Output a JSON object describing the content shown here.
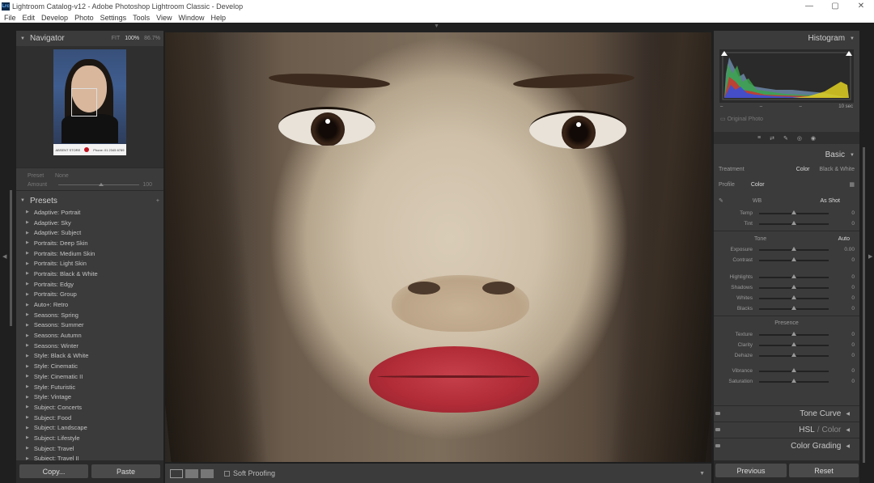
{
  "window": {
    "title": "Lightroom Catalog-v12 - Adobe Photoshop Lightroom Classic - Develop",
    "app_icon": "Lrc",
    "controls": [
      "—",
      "▢",
      "✕"
    ]
  },
  "menu": [
    "File",
    "Edit",
    "Develop",
    "Photo",
    "Settings",
    "Tools",
    "View",
    "Window",
    "Help"
  ],
  "left": {
    "navigator": {
      "title": "Navigator",
      "zoom": [
        "FIT",
        "100%",
        "86.7%"
      ],
      "selected_zoom": "100%",
      "preview_strip": [
        "ABSENT STORE",
        "Phone: 01 2345 6789"
      ]
    },
    "preset_amount": {
      "preset_label": "Preset",
      "preset_value": "None",
      "amount_label": "Amount",
      "amount_value": "100"
    },
    "presets": {
      "title": "Presets",
      "items": [
        "Adaptive: Portrait",
        "Adaptive: Sky",
        "Adaptive: Subject",
        "Portraits: Deep Skin",
        "Portraits: Medium Skin",
        "Portraits: Light Skin",
        "Portraits: Black & White",
        "Portraits: Edgy",
        "Portraits: Group",
        "Auto+: Retro",
        "Seasons: Spring",
        "Seasons: Summer",
        "Seasons: Autumn",
        "Seasons: Winter",
        "Style: Black & White",
        "Style: Cinematic",
        "Style: Cinematic II",
        "Style: Futuristic",
        "Style: Vintage",
        "Subject: Concerts",
        "Subject: Food",
        "Subject: Landscape",
        "Subject: Lifestyle",
        "Subject: Travel",
        "Subject: Travel II"
      ]
    },
    "buttons": {
      "copy": "Copy...",
      "paste": "Paste"
    }
  },
  "toolbar": {
    "soft_proofing": "Soft Proofing"
  },
  "right": {
    "histogram": {
      "title": "Histogram",
      "info": [
        "–",
        "–",
        "–",
        "10 sec"
      ],
      "original_photo": "Original Photo"
    },
    "tools": [
      "≡",
      "⇄",
      "✎",
      "◎",
      "◉"
    ],
    "basic": {
      "title": "Basic",
      "treatment_label": "Treatment",
      "treatment_options": [
        "Color",
        "Black & White"
      ],
      "profile_label": "Profile",
      "profile_value": "Color",
      "wb_label": "WB",
      "wb_value": "As Shot",
      "sliders_wb": [
        {
          "label": "Temp",
          "value": "0",
          "pos": 0.5
        },
        {
          "label": "Tint",
          "value": "0",
          "pos": 0.5
        }
      ],
      "tone_label": "Tone",
      "auto_label": "Auto",
      "sliders_tone": [
        {
          "label": "Exposure",
          "value": "0.00",
          "pos": 0.5
        },
        {
          "label": "Contrast",
          "value": "0",
          "pos": 0.5
        }
      ],
      "sliders_tone2": [
        {
          "label": "Highlights",
          "value": "0",
          "pos": 0.5
        },
        {
          "label": "Shadows",
          "value": "0",
          "pos": 0.5
        },
        {
          "label": "Whites",
          "value": "0",
          "pos": 0.5
        },
        {
          "label": "Blacks",
          "value": "0",
          "pos": 0.5
        }
      ],
      "presence_label": "Presence",
      "sliders_presence": [
        {
          "label": "Texture",
          "value": "0",
          "pos": 0.5
        },
        {
          "label": "Clarity",
          "value": "0",
          "pos": 0.5
        },
        {
          "label": "Dehaze",
          "value": "0",
          "pos": 0.5
        }
      ],
      "sliders_presence2": [
        {
          "label": "Vibrance",
          "value": "0",
          "pos": 0.5
        },
        {
          "label": "Saturation",
          "value": "0",
          "pos": 0.5
        }
      ]
    },
    "panels": {
      "tone_curve": "Tone Curve",
      "hsl": "HSL",
      "hsl_sep": "/",
      "hsl_color": "Color",
      "color_grading": "Color Grading"
    },
    "buttons": {
      "previous": "Previous",
      "reset": "Reset"
    }
  },
  "colors": {
    "panel": "#3b3b3b",
    "background": "#1f1f1f",
    "text": "#c4c4c4"
  }
}
